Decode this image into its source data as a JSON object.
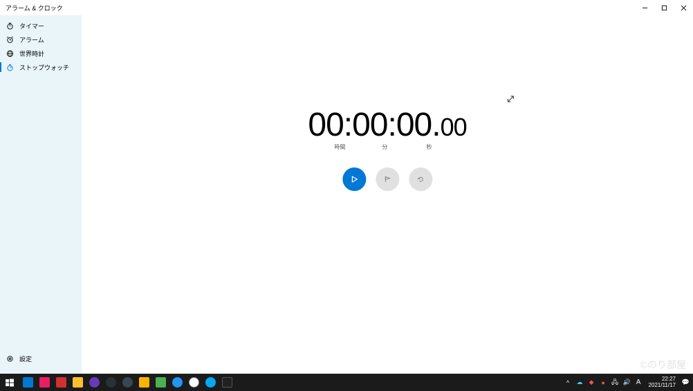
{
  "window": {
    "title": "アラーム & クロック",
    "controls": {
      "min": "—",
      "max": "▢",
      "close": "✕"
    }
  },
  "sidebar": {
    "items": [
      {
        "label": "タイマー",
        "icon": "timer"
      },
      {
        "label": "アラーム",
        "icon": "alarm"
      },
      {
        "label": "世界時計",
        "icon": "world"
      },
      {
        "label": "ストップウォッチ",
        "icon": "stopwatch"
      }
    ],
    "settings_label": "設定"
  },
  "stopwatch": {
    "hours": "00",
    "minutes": "00",
    "seconds": "00",
    "hundredths": "00",
    "label_hours": "時間",
    "label_minutes": "分",
    "label_seconds": "秒"
  },
  "taskbar": {
    "time": "22:27",
    "date": "2021/11/17",
    "ime": "A"
  },
  "watermark": "©のり部屋"
}
